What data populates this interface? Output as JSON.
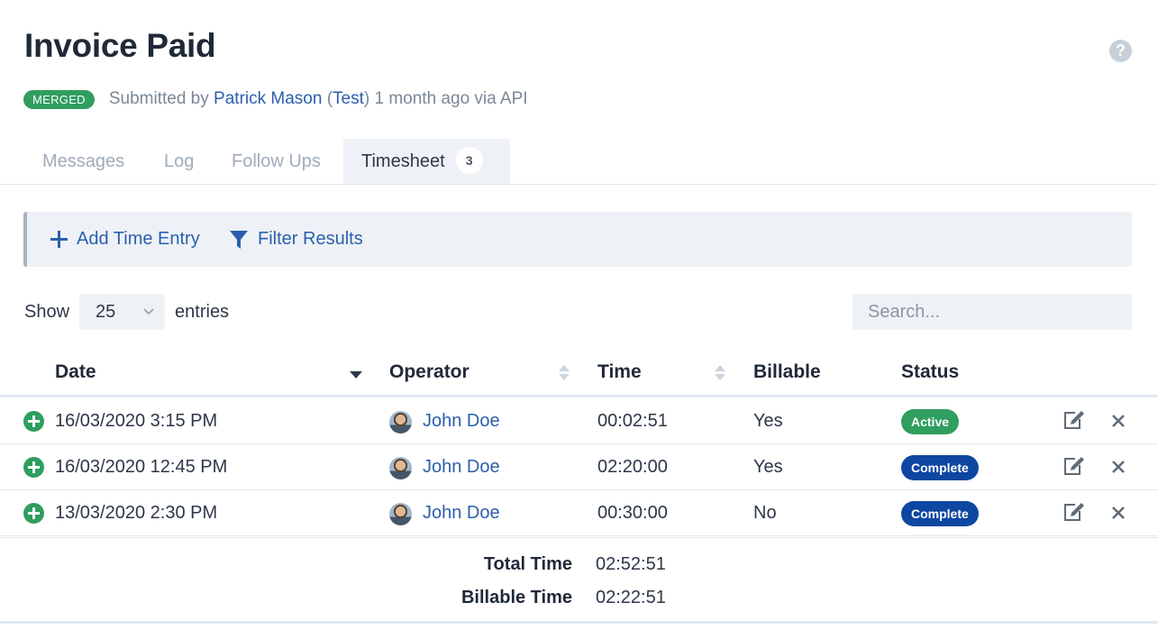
{
  "page": {
    "title": "Invoice Paid",
    "help_icon": "question-circle-icon"
  },
  "meta": {
    "badge": "MERGED",
    "badge_color": "#2f9e5f",
    "submitted_by_prefix": "Submitted by",
    "submitter_name": "Patrick Mason",
    "submitter_org_open": "(",
    "submitter_org": "Test",
    "submitter_org_close": ")",
    "time_ago": "1 month ago via API"
  },
  "tabs": [
    {
      "label": "Messages",
      "active": false
    },
    {
      "label": "Log",
      "active": false
    },
    {
      "label": "Follow Ups",
      "active": false
    },
    {
      "label": "Timesheet",
      "active": true,
      "count": "3"
    }
  ],
  "toolbar": {
    "add_label": "Add Time Entry",
    "add_icon": "plus-icon",
    "filter_label": "Filter Results",
    "filter_icon": "filter-icon"
  },
  "entries": {
    "show_label": "Show",
    "page_size": "25",
    "entries_label": "entries",
    "search_placeholder": "Search..."
  },
  "table": {
    "headers": {
      "date": "Date",
      "operator": "Operator",
      "time": "Time",
      "billable": "Billable",
      "status": "Status"
    },
    "rows": [
      {
        "date": "16/03/2020 3:15 PM",
        "operator": "John Doe",
        "time": "00:02:51",
        "billable": "Yes",
        "status": "Active",
        "status_color": "#2f9e5f"
      },
      {
        "date": "16/03/2020 12:45 PM",
        "operator": "John Doe",
        "time": "02:20:00",
        "billable": "Yes",
        "status": "Complete",
        "status_color": "#0d47a1"
      },
      {
        "date": "13/03/2020 2:30 PM",
        "operator": "John Doe",
        "time": "00:30:00",
        "billable": "No",
        "status": "Complete",
        "status_color": "#0d47a1"
      }
    ]
  },
  "totals": {
    "total_label": "Total Time",
    "total_value": "02:52:51",
    "billable_label": "Billable Time",
    "billable_value": "02:22:51"
  }
}
